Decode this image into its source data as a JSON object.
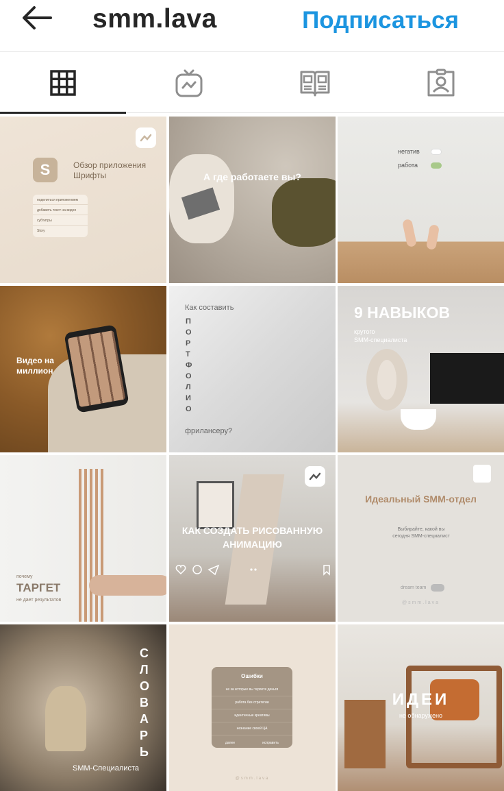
{
  "header": {
    "username": "smm.lava",
    "follow_label": "Подписаться"
  },
  "tabs": [
    {
      "name": "posts-grid",
      "icon": "grid-icon",
      "active": true
    },
    {
      "name": "igtv",
      "icon": "igtv-icon",
      "active": false
    },
    {
      "name": "guides",
      "icon": "guide-icon",
      "active": false
    },
    {
      "name": "tagged",
      "icon": "tagged-person-icon",
      "active": false
    }
  ],
  "posts": {
    "p1": {
      "title": "Обзор приложения Шрифты",
      "icon_letter": "S",
      "menu": [
        "поделиться приложением",
        "добавить текст на видео",
        "субтитры",
        "Story"
      ]
    },
    "p2": {
      "title": "А где работаете вы?"
    },
    "p3": {
      "opt1": "негатив",
      "opt2": "работа"
    },
    "p4": {
      "title": "Видео на миллион"
    },
    "p5": {
      "line1": "Как составить",
      "vertical": "ПОРТФОЛИО",
      "line3": "фрилансеру?"
    },
    "p6": {
      "title": "9 НАВЫКОВ",
      "sub1": "крутого",
      "sub2": "SMM-специалиста"
    },
    "p7": {
      "small": "почему",
      "title": "ТАРГЕТ",
      "sub": "не дает результатов"
    },
    "p8": {
      "title": "КАК СОЗДАТЬ РИСОВАННУЮ АНИМАЦИЮ"
    },
    "p9": {
      "title": "Идеальный SMM-отдел",
      "sub": "Выбирайте, какой вы сегодня SMM-специалист",
      "toggle_label": "dream team",
      "handle": "@smm.lava"
    },
    "p10": {
      "title": "СЛОВАРЬ",
      "sub": "SMM-Специалиста"
    },
    "p11": {
      "title": "Ошибки",
      "rows": [
        "не за которые вы теряете деньги",
        "работа без стратегии",
        "идентичные креативы",
        "незнание своей ЦА"
      ],
      "left_btn": "далее",
      "right_btn": "исправить",
      "handle": "@smm.lava"
    },
    "p12": {
      "title": "ИДЕИ",
      "sub": "не обнаружено"
    }
  },
  "colors": {
    "follow": "#1c95e0",
    "text": "#262626",
    "divider": "#e6e6e6"
  }
}
